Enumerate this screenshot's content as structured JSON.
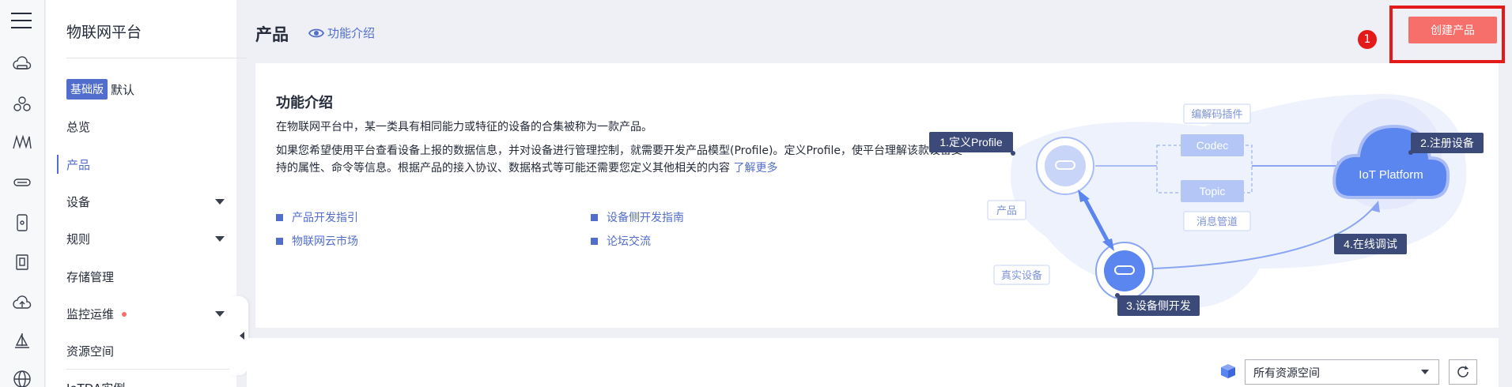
{
  "rail": {
    "icons": [
      "menu-icon",
      "cloud-server-icon",
      "cluster-icon",
      "m-logo-icon",
      "router-icon",
      "phone-icon",
      "document-icon",
      "cloud-upload-icon",
      "sailboat-icon",
      "globe-icon"
    ]
  },
  "sidebar": {
    "title": "物联网平台",
    "edition_badge": "基础版",
    "edition_label": "默认",
    "items": [
      {
        "label": "总览"
      },
      {
        "label": "产品"
      },
      {
        "label": "设备"
      },
      {
        "label": "规则"
      },
      {
        "label": "存储管理"
      },
      {
        "label": "监控运维"
      },
      {
        "label": "资源空间"
      },
      {
        "label": "IoTDA实例"
      }
    ]
  },
  "header": {
    "title": "产品",
    "feature_link": "功能介绍",
    "step_number": "1",
    "create_button": "创建产品"
  },
  "intro": {
    "heading": "功能介绍",
    "para1": "在物联网平台中，某一类具有相同能力或特征的设备的合集被称为一款产品。",
    "para2": "如果您希望使用平台查看设备上报的数据信息，并对设备进行管理控制，就需要开发产品模型(Profile)。定义Profile，使平台理解该款设备支持的属性、命令等信息。根据产品的接入协议、数据格式等可能还需要您定义其他相关的内容",
    "para2_link": "了解更多",
    "links": [
      "产品开发指引",
      "设备侧开发指南",
      "物联网云市场",
      "论坛交流"
    ]
  },
  "diagram": {
    "step1": "1.定义Profile",
    "step2": "2.注册设备",
    "step3": "3.设备侧开发",
    "step4": "4.在线调试",
    "codec_plugin": "编解码插件",
    "codec": "Codec",
    "topic": "Topic",
    "message_channel": "消息管道",
    "product": "产品",
    "real_device": "真实设备",
    "platform": "IoT Platform"
  },
  "toolbar": {
    "resource_space": "所有资源空间"
  },
  "colors": {
    "accent": "#526ecc",
    "primary_button": "#f66f6a",
    "highlight": "#e4191a"
  }
}
